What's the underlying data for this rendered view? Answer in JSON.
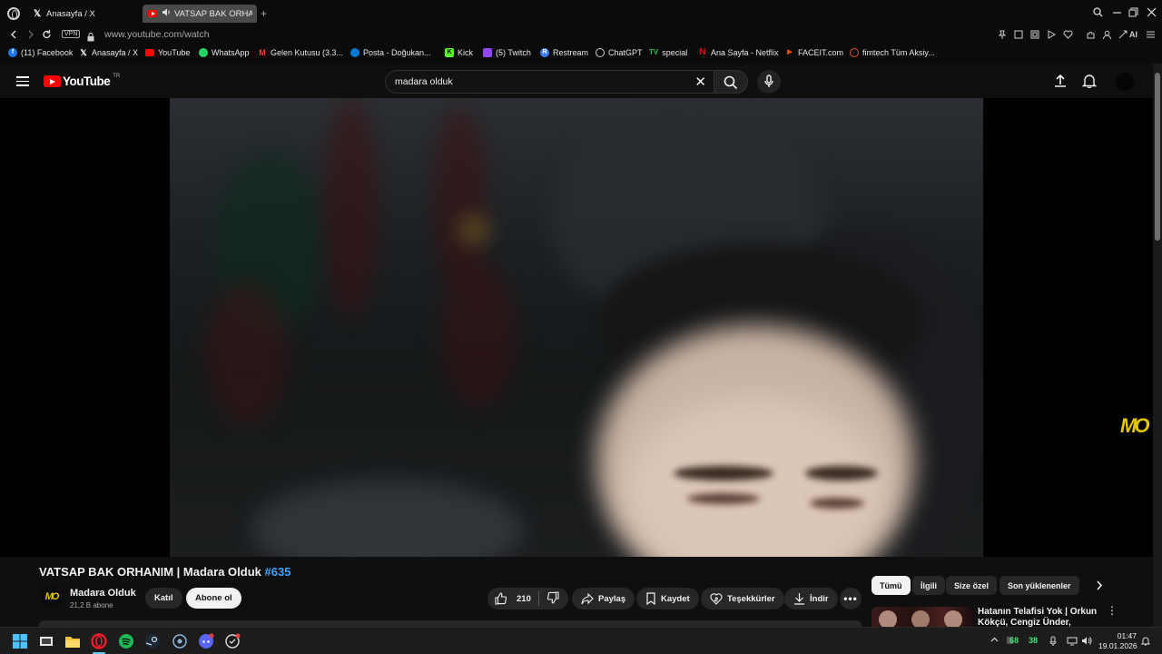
{
  "browser": {
    "tabs": [
      {
        "label": "Anasayfa / X",
        "icon": "x-logo-icon"
      },
      {
        "label": "VATSAP BAK ORHANIM",
        "icon": "youtube-icon",
        "audio": true
      }
    ],
    "url": "www.youtube.com/watch",
    "vpn_label": "VPN",
    "extension_ai_label": "AI"
  },
  "bookmarks": [
    {
      "label": "(11) Facebook",
      "color": "#1877f2"
    },
    {
      "label": "Anasayfa / X",
      "color": "#000000"
    },
    {
      "label": "YouTube",
      "color": "#ff0000"
    },
    {
      "label": "WhatsApp",
      "color": "#25d366"
    },
    {
      "label": "Gelen Kutusu (3.3...",
      "color": "#ea4335"
    },
    {
      "label": "Posta - Doğukan...",
      "color": "#0078d4"
    },
    {
      "label": "Kick",
      "color": "#53fc18"
    },
    {
      "label": "(5) Twitch",
      "color": "#9146ff"
    },
    {
      "label": "Restream",
      "color": "#3e7bfa"
    },
    {
      "label": "ChatGPT",
      "color": "#d0d0d0"
    },
    {
      "label": "special",
      "color": "#2dba4e"
    },
    {
      "label": "Ana Sayfa - Netflix",
      "color": "#e50914"
    },
    {
      "label": "FACEIT.com",
      "color": "#ff5500"
    },
    {
      "label": "fimtech Tüm Aksiy...",
      "color": "#e0522c"
    }
  ],
  "youtube": {
    "logo_text": "YouTube",
    "region": "TR",
    "search_value": "madara olduk",
    "video": {
      "title_main": "VATSAP BAK ORHANIM | Madara Olduk ",
      "title_hashtag": "#635",
      "watermark": "MO"
    },
    "channel": {
      "name": "Madara Olduk",
      "subscribers": "21,2 B abone",
      "avatar_text": "MO",
      "join_label": "Katıl",
      "subscribe_label": "Abone ol"
    },
    "actions": {
      "likes": "210",
      "share": "Paylaş",
      "save": "Kaydet",
      "thanks": "Teşekkürler",
      "download": "İndir"
    },
    "chips": [
      "Tümü",
      "İlgili",
      "Size özel",
      "Son yüklenenler"
    ],
    "recommendation": {
      "title": "Hatanın Telafisi Yok | Orkun Kökçü, Cengiz Ünder, Emirhan"
    }
  },
  "taskbar": {
    "tray_green_1": "68",
    "tray_green_2": "38",
    "time": "01:47",
    "date": "19.01.2026"
  }
}
